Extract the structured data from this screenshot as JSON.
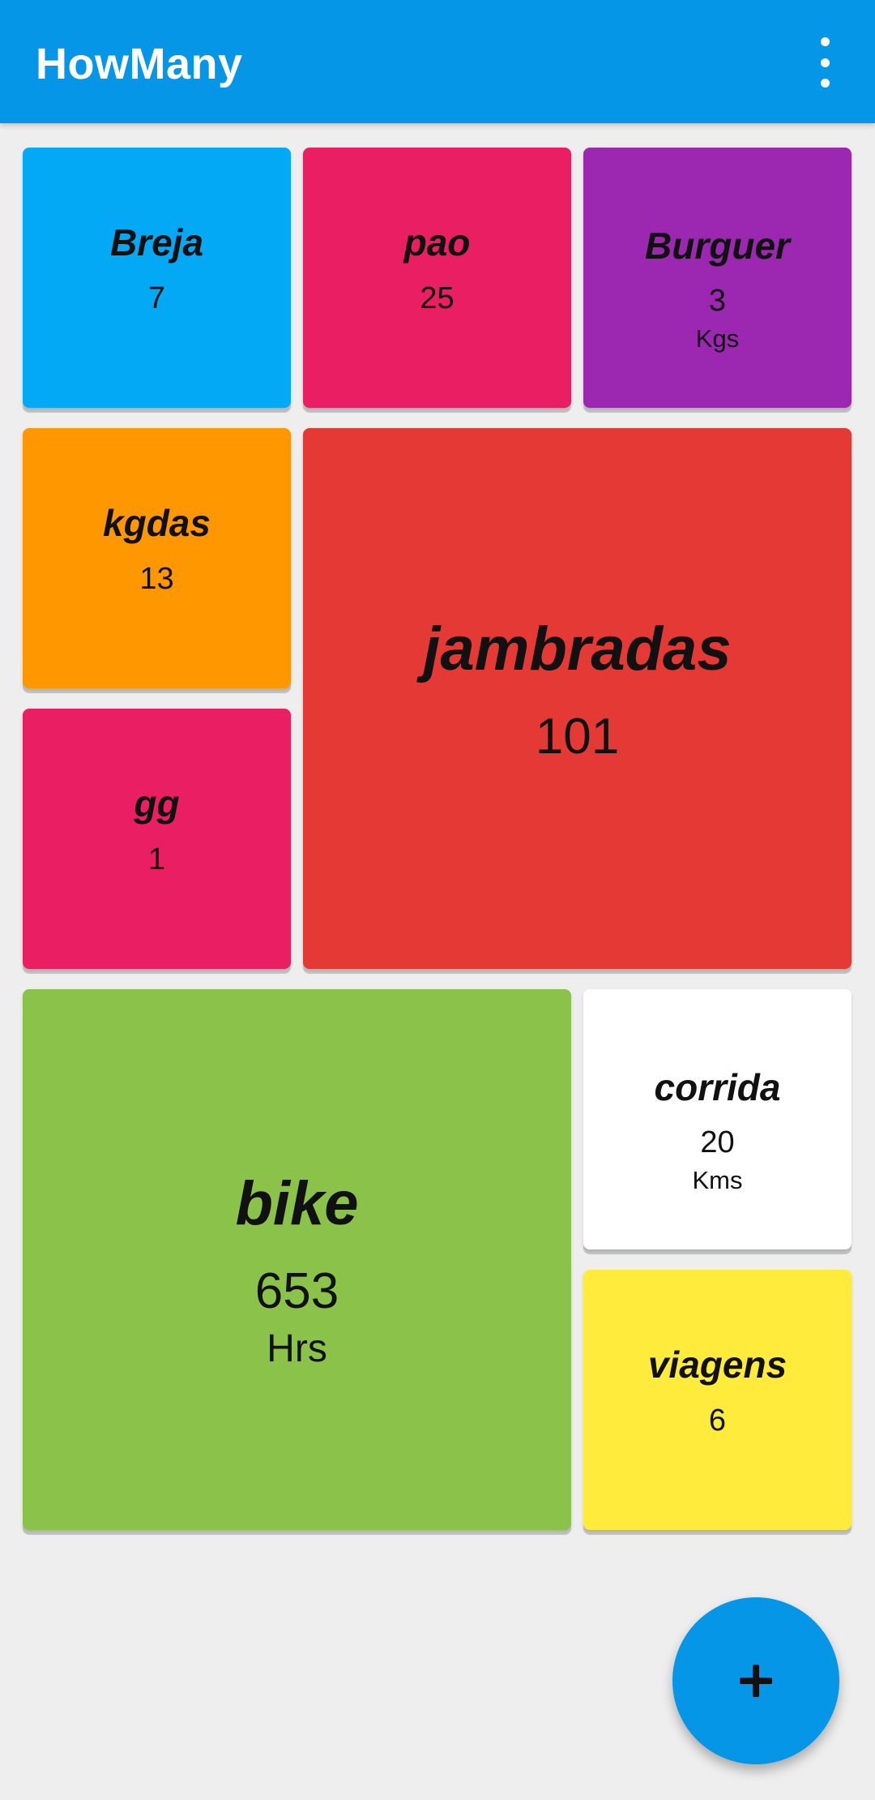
{
  "app": {
    "title": "HowMany",
    "theme_color": "#0596e8",
    "menu_icon": "more-vert-icon"
  },
  "counters": [
    {
      "name": "Breja",
      "count": "7",
      "unit": "",
      "color": "#03a9f4"
    },
    {
      "name": "pao",
      "count": "25",
      "unit": "",
      "color": "#e91e63"
    },
    {
      "name": "Burguer",
      "count": "3",
      "unit": "Kgs",
      "color": "#9c27b0"
    },
    {
      "name": "kgdas",
      "count": "13",
      "unit": "",
      "color": "#ff9800"
    },
    {
      "name": "jambradas",
      "count": "101",
      "unit": "",
      "color": "#e53935"
    },
    {
      "name": "gg",
      "count": "1",
      "unit": "",
      "color": "#e91e63"
    },
    {
      "name": "bike",
      "count": "653",
      "unit": "Hrs",
      "color": "#8bc34a"
    },
    {
      "name": "corrida",
      "count": "20",
      "unit": "Kms",
      "color": "#ffffff"
    },
    {
      "name": "viagens",
      "count": "6",
      "unit": "",
      "color": "#ffeb3b"
    }
  ],
  "fab": {
    "icon": "plus-icon"
  }
}
